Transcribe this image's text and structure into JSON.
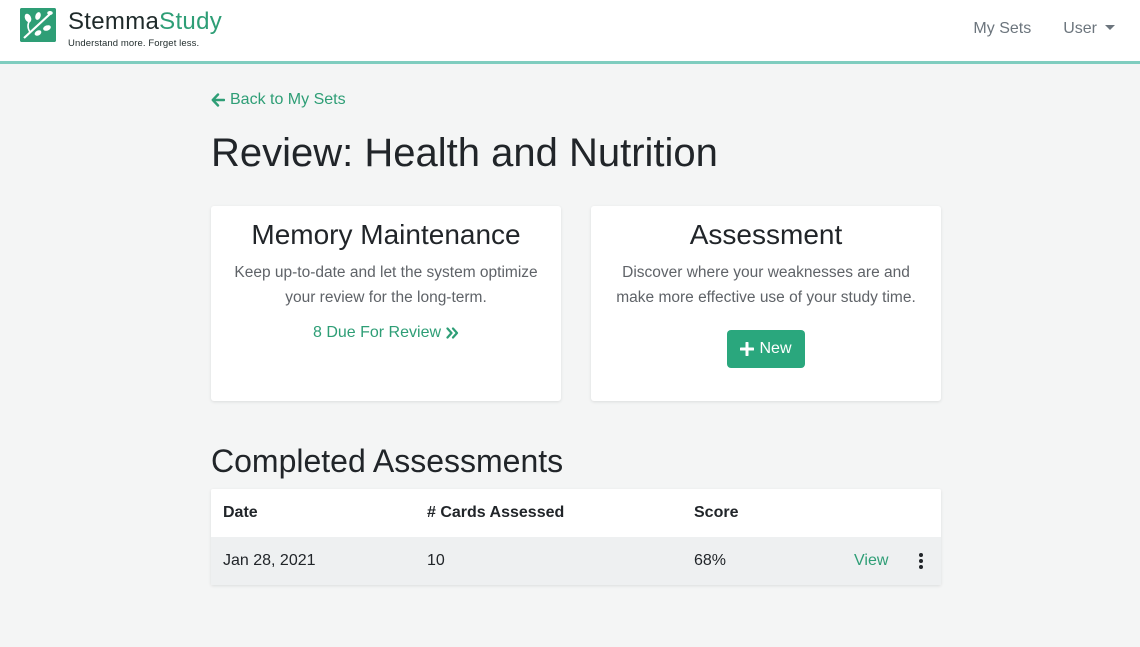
{
  "navbar": {
    "brand_part1": "Stemma",
    "brand_part2": "Study",
    "tagline": "Understand more. Forget less.",
    "my_sets": "My Sets",
    "user": "User"
  },
  "back_link": "Back to My Sets",
  "page_title": "Review: Health and Nutrition",
  "memory_card": {
    "title": "Memory Maintenance",
    "text": "Keep up-to-date and let the system optimize your review for the long-term.",
    "due_link": "8 Due For Review"
  },
  "assessment_card": {
    "title": "Assessment",
    "text": "Discover where your weaknesses are and make more effective use of your study time.",
    "new_button": "New"
  },
  "completed": {
    "title": "Completed Assessments",
    "headers": [
      "Date",
      "# Cards Assessed",
      "Score"
    ],
    "rows": [
      {
        "date": "Jan 28, 2021",
        "cards": "10",
        "score": "68%",
        "action": "View"
      }
    ]
  },
  "colors": {
    "accent": "#2e9e76",
    "navbar_border": "#7fcdbf",
    "background": "#f4f5f5"
  },
  "icons": {
    "logo": "leaf-logo-icon",
    "back": "arrow-left-icon",
    "due": "double-chevron-right-icon",
    "new": "plus-icon",
    "more": "vertical-ellipsis-icon",
    "user": "caret-down-icon"
  }
}
